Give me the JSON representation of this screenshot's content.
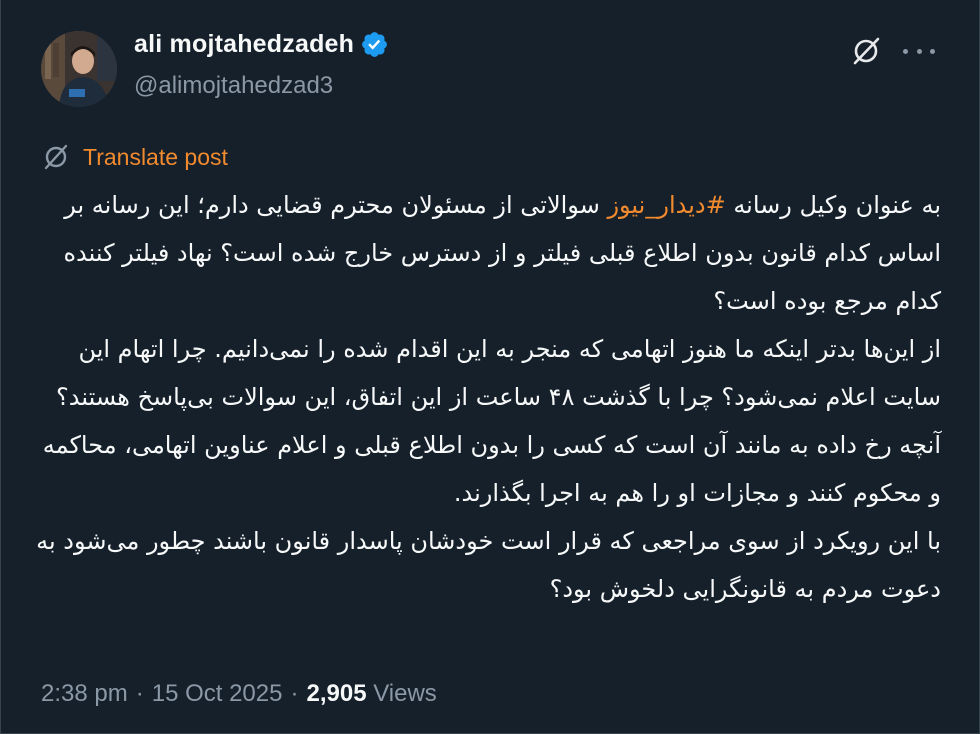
{
  "author": {
    "display_name": "ali mojtahedzadeh",
    "handle": "@alimojtahedzad3",
    "verified": true,
    "verified_color": "#1d9bf0"
  },
  "actions": {
    "grok_icon": "grok-slash-circle-icon",
    "more_icon": "more-horizontal-icon"
  },
  "translate": {
    "label": "Translate post",
    "icon": "translate-slash-circle-icon"
  },
  "post": {
    "line1_before": "به عنوان وکیل رسانه ",
    "hashtag": "#دیدار_نیوز",
    "line1_after": " سوالاتی از مسئولان محترم قضایی دارم؛ این رسانه بر اساس کدام قانون بدون اطلاع قبلی فیلتر و از دسترس خارج شده است؟ نهاد فیلتر کننده کدام مرجع بوده است؟",
    "paragraph2": "از این‌ها بدتر اینکه ما هنوز اتهامی که منجر به این اقدام شده را نمی‌دانیم. چرا اتهام این سایت اعلام نمی‌شود؟ چرا با گذشت ۴۸ ساعت از این اتفاق، این سوالات بی‌پاسخ هستند؟",
    "paragraph3": "آنچه رخ داده به مانند آن است که کسی را بدون اطلاع قبلی و اعلام عناوین اتهامی، محاکمه و محکوم کنند و مجازات او را هم به اجرا بگذارند.",
    "paragraph4": "با این رویکرد از سوی مراجعی که قرار است خودشان پاسدار قانون باشند چطور می‌شود به دعوت مردم به قانونگرایی دلخوش بود؟"
  },
  "meta": {
    "time": "2:38 pm",
    "separator": "·",
    "date": "15 Oct 2025",
    "views_count": "2,905",
    "views_label": "Views"
  },
  "colors": {
    "background": "#15202b",
    "text": "#f7f9f9",
    "secondary": "#8b98a5",
    "accent": "#f28a2e"
  }
}
